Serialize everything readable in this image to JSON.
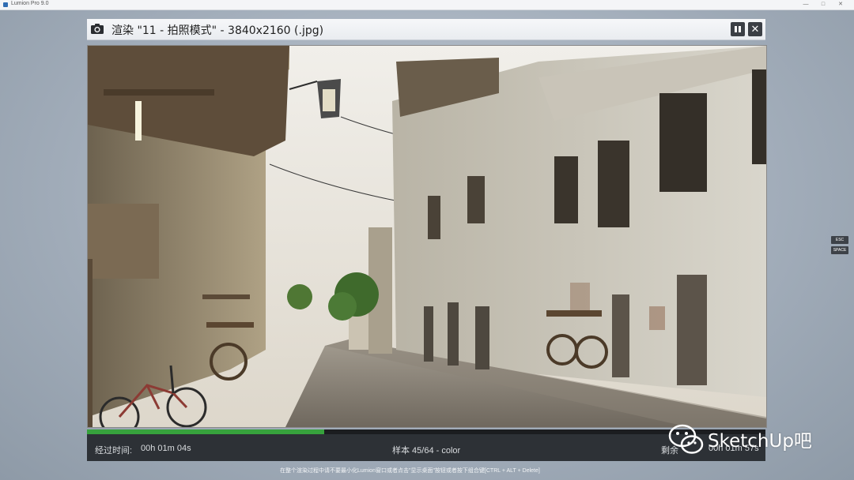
{
  "os": {
    "window_title": "Lumion Pro 9.0",
    "controls": [
      "—",
      "□",
      "✕"
    ]
  },
  "dialog": {
    "title": "渲染 \"11 - 拍照模式\" - 3840x2160 (.jpg)",
    "camera_icon": "camera-icon",
    "pause_icon": "pause-icon",
    "close_icon": "close-icon",
    "close_glyph": "✕"
  },
  "status": {
    "progress": 0.35,
    "elapsed_label": "经过时间:",
    "elapsed_value": "00h 01m 04s",
    "sample": "样本 45/64 - color",
    "remaining_label": "剩余",
    "remaining_value": "00h 01m 57s"
  },
  "hint": "在整个渲染过程中请不要最小化Lumion窗口或者点击\"显示桌面\"按钮或者按下组合键[CTRL + ALT + Delete]",
  "shortcuts": {
    "esc": "ESC",
    "space": "SPACE"
  },
  "watermark": {
    "text": "SketchUp吧",
    "icon": "wechat-icon"
  },
  "colors": {
    "progress": "#37a23d",
    "panel": "#2d3136",
    "header": "#eef0f3"
  }
}
